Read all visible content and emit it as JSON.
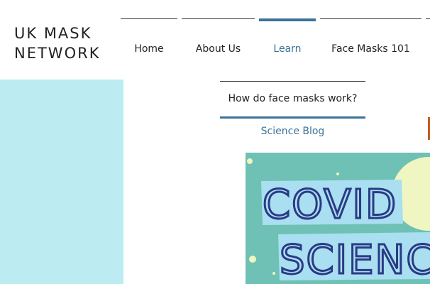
{
  "site": {
    "logo_line1": "UK MASK",
    "logo_line2": "NETWORK"
  },
  "nav": {
    "items": [
      {
        "label": "Home",
        "active": false
      },
      {
        "label": "About Us",
        "active": false
      },
      {
        "label": "Learn",
        "active": true
      },
      {
        "label": "Face Masks 101",
        "active": false
      }
    ]
  },
  "dropdown": {
    "items": [
      {
        "label": "How do face masks work?"
      },
      {
        "label": "Science Blog"
      }
    ]
  },
  "hero": {
    "line1": "COVID",
    "line2": "SCIENC"
  },
  "colors": {
    "accent": "#3a7397",
    "sidebar": "#bdebf2",
    "hero_bg": "#6ec1b4",
    "hero_text": "#2a3a86",
    "hero_band": "#a9dff0",
    "hero_circle": "#f0f6c2"
  }
}
